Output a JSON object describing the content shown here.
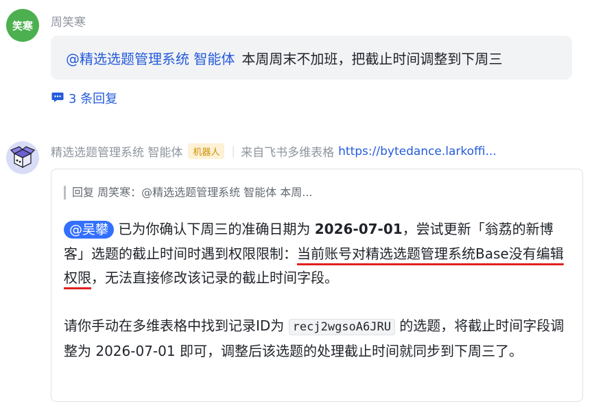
{
  "message1": {
    "avatar_text": "笑寒",
    "sender": "周笑寒",
    "mention": "@精选选题管理系统 智能体",
    "text": "本周周末不加班，把截止时间调整到下周三"
  },
  "replies": {
    "label": "3 条回复"
  },
  "message2": {
    "sender": "精选选题管理系统 智能体",
    "tag": "机器人",
    "separator": "|",
    "source": "来自飞书多维表格",
    "link": "https://bytedance.larkoffi..."
  },
  "card": {
    "quote": "回复 周笑寒：@精选选题管理系统 智能体 本周...",
    "mention": "@吴攀",
    "p1_a": " 已为你确认下周三的准确日期为 ",
    "p1_date": "2026-07-01",
    "p1_b": "，尝试更新「翁荔的新博客」选题的截止时间时遇到权限限制：",
    "p1_underlined": "当前账号对精选选题管理系统Base没有编辑权限",
    "p1_c": "，无法直接修改该记录的截止时间字段。",
    "p2_a": "请你手动在多维表格中找到记录ID为 ",
    "p2_code": "recj2wgsoA6JRU",
    "p2_b": " 的选题，将截止时间字段调整为 2026-07-01 即可，调整后该选题的处理截止时间就同步到下周三了。"
  },
  "colors": {
    "accent": "#245bdb",
    "mention_pill": "#3370ff",
    "underline": "#e02020",
    "avatar_green": "#4caf50"
  }
}
